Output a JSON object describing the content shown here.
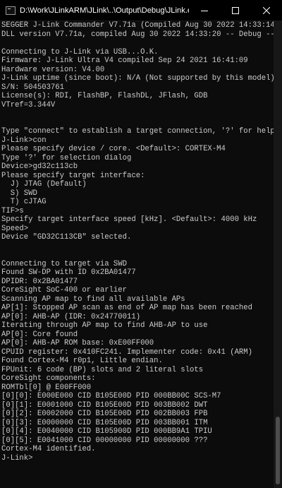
{
  "window": {
    "title": "D:\\Work\\JLinkARM\\JLink\\..\\Output\\Debug\\JLink.exe",
    "controls": [
      "minimize-icon",
      "maximize-icon",
      "close-icon"
    ]
  },
  "console": {
    "lines": [
      "SEGGER J-Link Commander V7.71a (Compiled Aug 30 2022 14:33:14)",
      "DLL version V7.71a, compiled Aug 30 2022 14:33:20 -- Debug --",
      "",
      "Connecting to J-Link via USB...O.K.",
      "Firmware: J-Link Ultra V4 compiled Sep 24 2021 16:41:09",
      "Hardware version: V4.00",
      "J-Link uptime (since boot): N/A (Not supported by this model)",
      "S/N: 504503761",
      "License(s): RDI, FlashBP, FlashDL, JFlash, GDB",
      "VTref=3.344V",
      "",
      "",
      "Type \"connect\" to establish a target connection, '?' for help",
      "J-Link>con",
      "Please specify device / core. <Default>: CORTEX-M4",
      "Type '?' for selection dialog",
      "Device>gd32c113cb",
      "Please specify target interface:",
      "  J) JTAG (Default)",
      "  S) SWD",
      "  T) cJTAG",
      "TIF>s",
      "Specify target interface speed [kHz]. <Default>: 4000 kHz",
      "Speed>",
      "Device \"GD32C113CB\" selected.",
      "",
      "",
      "Connecting to target via SWD",
      "Found SW-DP with ID 0x2BA01477",
      "DPIDR: 0x2BA01477",
      "CoreSight SoC-400 or earlier",
      "Scanning AP map to find all available APs",
      "AP[1]: Stopped AP scan as end of AP map has been reached",
      "AP[0]: AHB-AP (IDR: 0x24770011)",
      "Iterating through AP map to find AHB-AP to use",
      "AP[0]: Core found",
      "AP[0]: AHB-AP ROM base: 0xE00FF000",
      "CPUID register: 0x410FC241. Implementer code: 0x41 (ARM)",
      "Found Cortex-M4 r0p1, Little endian.",
      "FPUnit: 6 code (BP) slots and 2 literal slots",
      "CoreSight components:",
      "ROMTbl[0] @ E00FF000",
      "[0][0]: E000E000 CID B105E00D PID 000BB00C SCS-M7",
      "[0][1]: E0001000 CID B105E00D PID 003BB002 DWT",
      "[0][2]: E0002000 CID B105E00D PID 002BB003 FPB",
      "[0][3]: E0000000 CID B105E00D PID 003BB001 ITM",
      "[0][4]: E0040000 CID B105900D PID 000BB9A1 TPIU",
      "[0][5]: E0041000 CID 00000000 PID 00000000 ???",
      "Cortex-M4 identified.",
      "J-Link>"
    ]
  }
}
